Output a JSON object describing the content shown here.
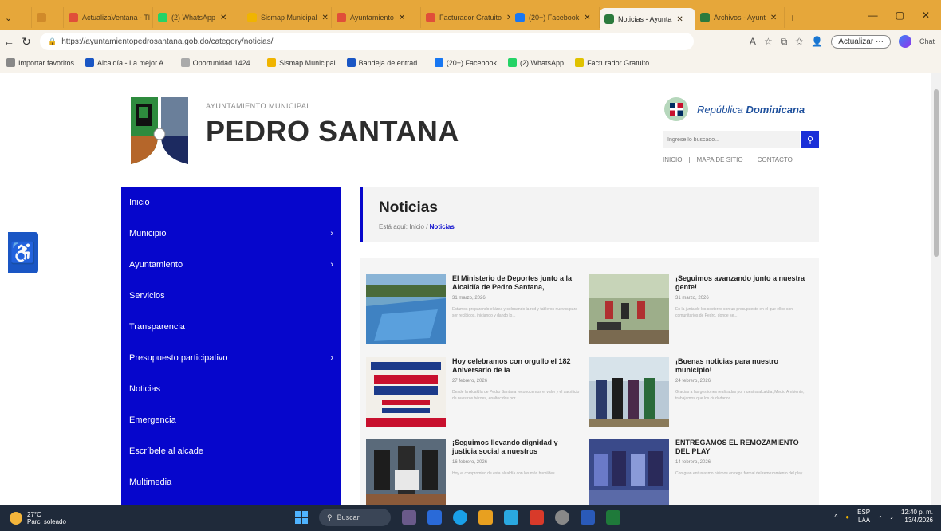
{
  "browser": {
    "tabs": [
      {
        "label": "ActualizaVentana - Tl",
        "color": "#e04e39"
      },
      {
        "label": "(2) WhatsApp",
        "color": "#25d366"
      },
      {
        "label": "Sismap Municipal",
        "color": "#f0b400"
      },
      {
        "label": "Ayuntamiento",
        "color": "#e04e39"
      },
      {
        "label": "Facturador Gratuito",
        "color": "#e04e39"
      },
      {
        "label": "(20+) Facebook",
        "color": "#1877f2"
      },
      {
        "label": "Noticias - Ayunta",
        "color": "#2b7a3d"
      },
      {
        "label": "Archivos - Ayunt",
        "color": "#2b7a3d"
      }
    ],
    "url": "https://ayuntamientopedrosantana.gob.do/category/noticias/",
    "update_label": "Actualizar",
    "chat_label": "Chat",
    "bookmarks": [
      {
        "label": "Importar favoritos",
        "color": "#888888"
      },
      {
        "label": "Alcaldía - La mejor A...",
        "color": "#1a56c4"
      },
      {
        "label": "Oportunidad 1424...",
        "color": "#aaaaaa"
      },
      {
        "label": "Sismap Municipal",
        "color": "#f0b400"
      },
      {
        "label": "Bandeja de entrad...",
        "color": "#1a56c4"
      },
      {
        "label": "(20+) Facebook",
        "color": "#1877f2"
      },
      {
        "label": "(2) WhatsApp",
        "color": "#25d366"
      },
      {
        "label": "Facturador Gratuito",
        "color": "#e0c200"
      }
    ]
  },
  "site": {
    "small_title": "AYUNTAMIENTO MUNICIPAL",
    "title": "PEDRO SANTANA",
    "country_prefix": "República ",
    "country_bold": "Dominicana",
    "search_placeholder": "Ingrese lo buscado...",
    "toplinks": [
      "INICIO",
      "|",
      "MAPA DE SITIO",
      "|",
      "CONTACTO"
    ]
  },
  "sidebar": {
    "items": [
      {
        "label": "Inicio",
        "chevron": ""
      },
      {
        "label": "Municipio",
        "chevron": "›"
      },
      {
        "label": "Ayuntamiento",
        "chevron": "›"
      },
      {
        "label": "Servicios",
        "chevron": ""
      },
      {
        "label": "Transparencia",
        "chevron": ""
      },
      {
        "label": "Presupuesto participativo",
        "chevron": "›"
      },
      {
        "label": "Noticias",
        "chevron": ""
      },
      {
        "label": "Emergencia",
        "chevron": ""
      },
      {
        "label": "Escríbele al alcade",
        "chevron": ""
      },
      {
        "label": "Multimedia",
        "chevron": ""
      }
    ]
  },
  "news": {
    "title": "Noticias",
    "breadcrumb_prefix": "Está aquí:",
    "breadcrumb_home": "Inicio",
    "breadcrumb_sep": "/",
    "breadcrumb_current": "Noticias",
    "cards": [
      {
        "title": "El Ministerio de Deportes junto a la Alcaldía de Pedro Santana,",
        "date": "31 marzo, 2026",
        "excerpt": "Estamos preparando el área y colocando la red y tableros nuevos para ser recibidos, iniciando y dando lo..."
      },
      {
        "title": "¡Seguimos avanzando junto a nuestra gente!",
        "date": "31 marzo, 2026",
        "excerpt": "En la junta de los sectores con un presupuesto en el que ellos son comunitarios de Pedro, donde se..."
      },
      {
        "title": "Hoy celebramos con orgullo el 182 Aniversario de la",
        "date": "27 febrero, 2026",
        "excerpt": "Desde la Alcaldía de Pedro Santana reconocemos el valor y el sacrificio de nuestros héroes, enaltecidos por..."
      },
      {
        "title": "¡Buenas noticias para nuestro municipio!",
        "date": "24 febrero, 2026",
        "excerpt": "Gracias a las gestiones realizadas por nuestra alcaldía, Medio Ambiente, trabajamos que los ciudadanos..."
      },
      {
        "title": "¡Seguimos llevando dignidad y justicia social a nuestros",
        "date": "16 febrero, 2026",
        "excerpt": "Hoy el compromiso de esta alcaldía con los más humildes..."
      },
      {
        "title": "ENTREGAMOS EL REMOZAMIENTO DEL PLAY",
        "date": "14 febrero, 2026",
        "excerpt": "Con gran entusiasmo hicimos entrega formal del remozamiento del play..."
      }
    ]
  },
  "taskbar": {
    "weather_temp": "27°C",
    "weather_desc": "Parc. soleado",
    "search_label": "Buscar",
    "lang": "ESP",
    "lang2": "LAA",
    "time": "12:40 p. m.",
    "date": "13/4/2026"
  }
}
